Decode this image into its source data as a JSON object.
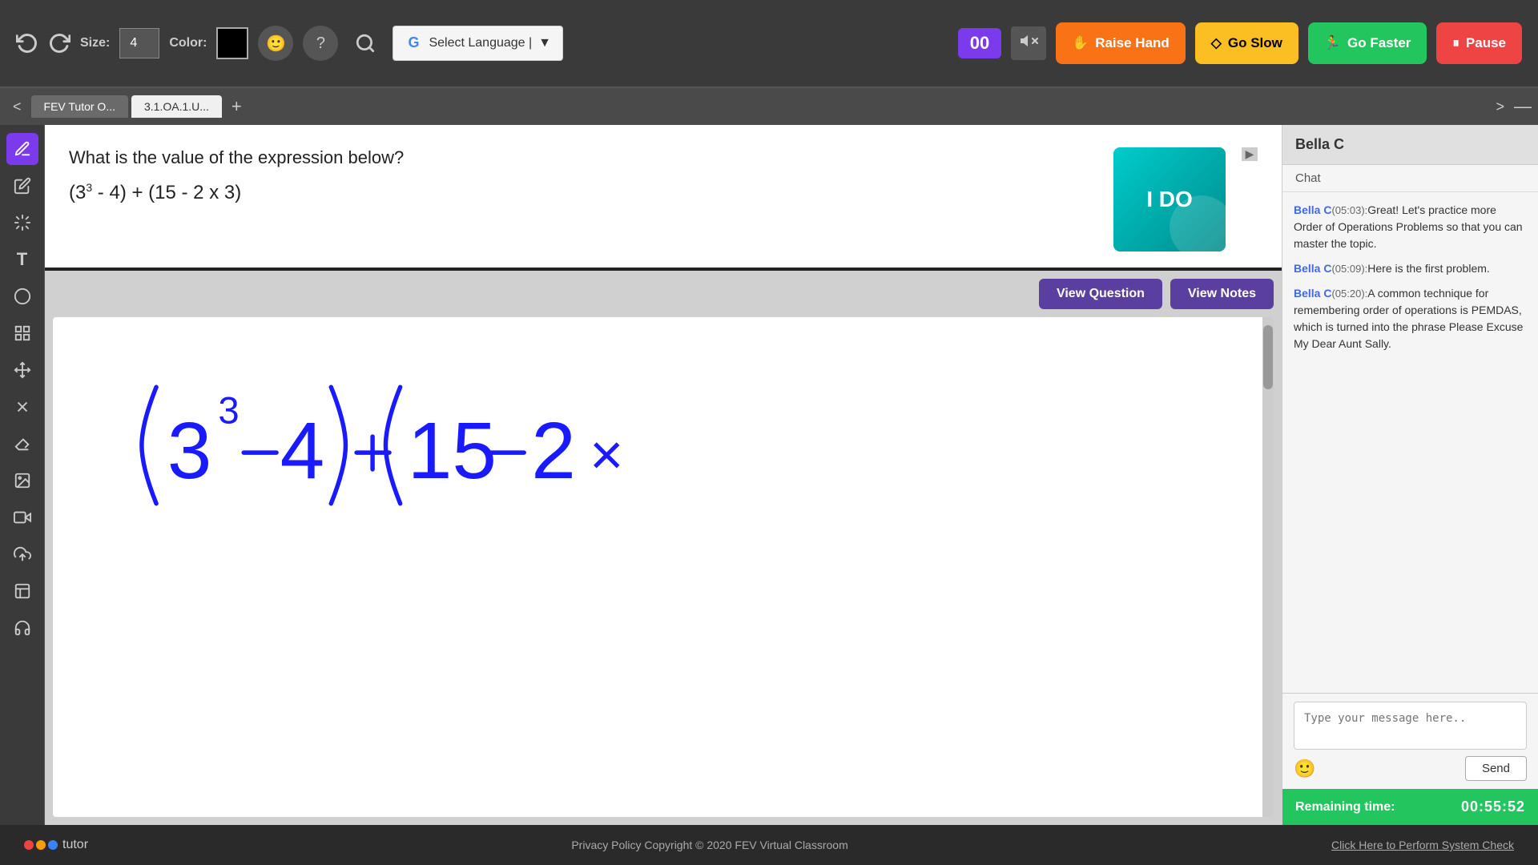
{
  "toolbar": {
    "size_label": "Size:",
    "size_value": "4",
    "color_label": "Color:",
    "language_button": "Select Language  |",
    "timer_value": "00",
    "raise_hand": "Raise Hand",
    "go_slow": "Go Slow",
    "go_faster": "Go Faster",
    "pause": "Pause"
  },
  "tabs": [
    {
      "label": "FEV Tutor O...",
      "active": false
    },
    {
      "label": "3.1.OA.1.U...",
      "active": true
    }
  ],
  "question": {
    "title": "What is the value of the expression below?",
    "expression": "(3³ - 4) + (15 - 2 x 3)",
    "mode_card": "I DO"
  },
  "whiteboard": {
    "view_question_btn": "View Question",
    "view_notes_btn": "View Notes"
  },
  "chat": {
    "student_name": "Bella C",
    "chat_label": "Chat",
    "messages": [
      {
        "sender": "Bella C",
        "timestamp": "05:03",
        "text": "Great! Let's practice more Order of Operations Problems so that you can master the topic."
      },
      {
        "sender": "Bella C",
        "timestamp": "05:09",
        "text": "Here is the first problem."
      },
      {
        "sender": "Bella C",
        "timestamp": "05:20",
        "text": "A common technique for remembering order of operations is PEMDAS, which is turned into the phrase Please Excuse My Dear Aunt Sally."
      }
    ],
    "input_placeholder": "Type your message here..",
    "send_btn": "Send"
  },
  "timer": {
    "label": "Remaining time:",
    "value": "00:55:52"
  },
  "footer": {
    "logo_text": "tutor",
    "copyright": "Privacy Policy Copyright © 2020 FEV Virtual Classroom",
    "system_check": "Click Here to Perform System Check"
  }
}
